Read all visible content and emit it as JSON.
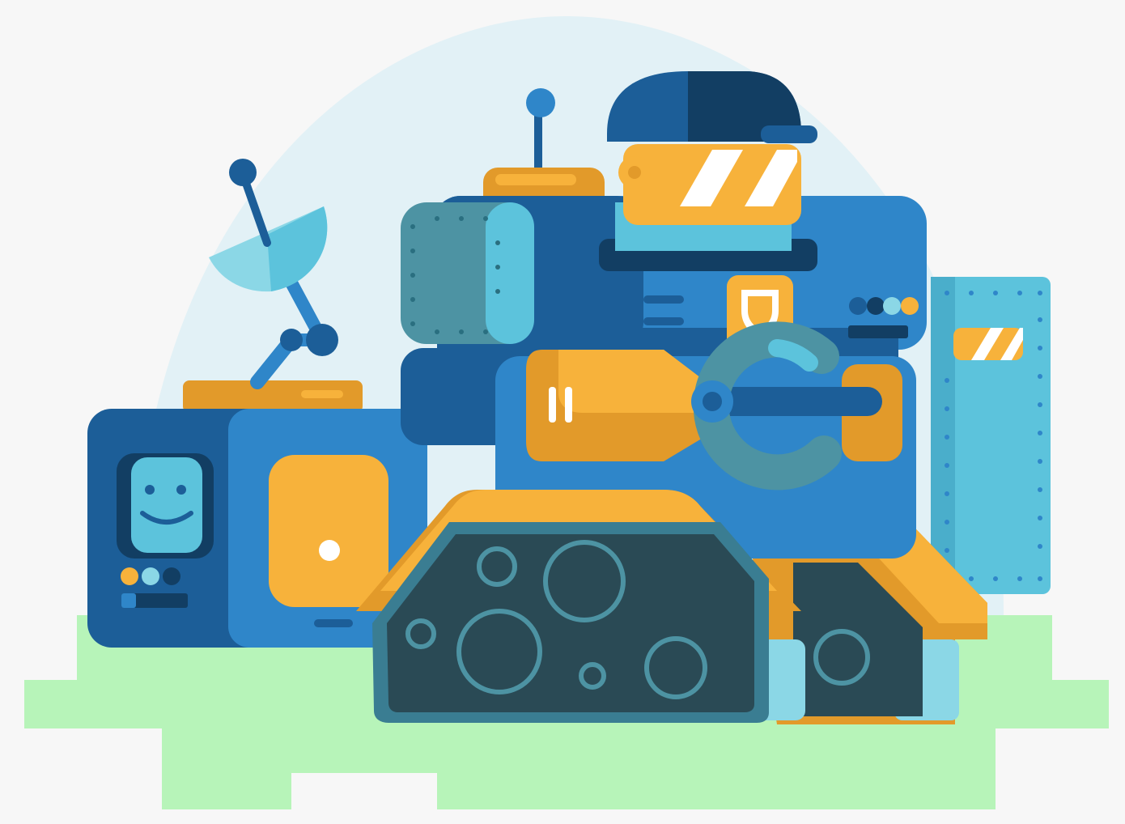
{
  "scene": {
    "subject": "robot-tank-with-pilot",
    "colors": {
      "background": "#f7f7f7",
      "sky_dome": "#e2f1f6",
      "ground": "#b7f4b9",
      "deep_blue": "#1c5e98",
      "mid_blue": "#2f86c9",
      "bright_blue": "#3b8fd6",
      "cyan": "#5cc3dc",
      "light_cyan": "#8bd7e6",
      "teal_gray": "#4d93a3",
      "dark_teal": "#2a4a55",
      "orange": "#f7b23b",
      "dark_orange": "#e29a2a",
      "white": "#ffffff"
    },
    "icons": [
      "satellite-dish-icon",
      "smiley-face-screen-icon",
      "pilot-helmet-icon",
      "shield-badge-icon",
      "claw-arm-icon",
      "caterpillar-track-icon",
      "riveted-shield-panel-icon"
    ]
  }
}
